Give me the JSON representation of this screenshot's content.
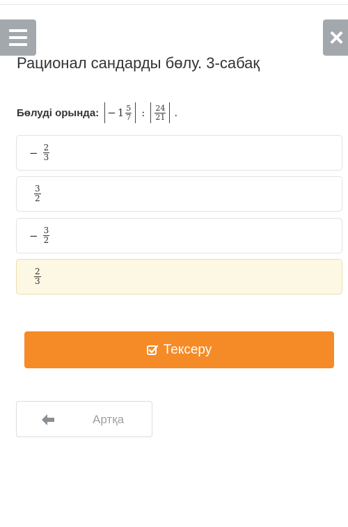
{
  "header": {
    "menu_icon": "hamburger-menu-icon",
    "close_icon": "close-x-icon",
    "close_glyph": "×"
  },
  "lesson": {
    "title": "Рационал сандарды бөлу. 3-сабақ"
  },
  "question": {
    "label": "Бөлуді орында:",
    "expression": {
      "a_sign": "−",
      "a_whole": "1",
      "a_num": "5",
      "a_den": "7",
      "op": ":",
      "b_num": "24",
      "b_den": "21",
      "end": "."
    }
  },
  "options": [
    {
      "sign": "−",
      "num": "2",
      "den": "3",
      "selected": false
    },
    {
      "sign": "",
      "num": "3",
      "den": "2",
      "selected": false
    },
    {
      "sign": "−",
      "num": "3",
      "den": "2",
      "selected": false
    },
    {
      "sign": "",
      "num": "2",
      "den": "3",
      "selected": true
    }
  ],
  "actions": {
    "check_label": "Тексеру",
    "check_icon": "checkbox-check-icon",
    "back_label": "Артқа",
    "back_icon": "arrow-left-icon"
  },
  "colors": {
    "accent": "#f58b26",
    "selected_bg": "#fcf8e3",
    "header_btn": "#a3a8ad"
  }
}
